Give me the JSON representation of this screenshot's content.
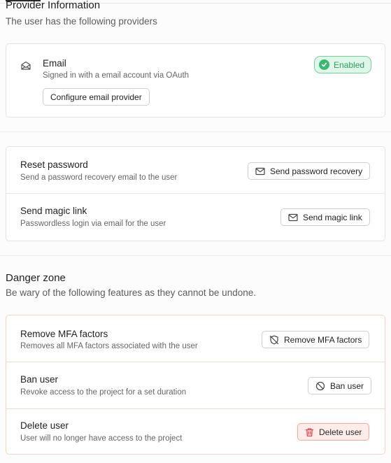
{
  "provider_section": {
    "title": "Provider Information",
    "subtitle": "The user has the following providers",
    "provider": {
      "icon": "mail-open-icon",
      "name": "Email",
      "description": "Signed in with a email account via OAuth",
      "configure_label": "Configure email provider",
      "status_label": "Enabled",
      "status_icon": "check-circle-icon",
      "status_color": "#3bb873"
    }
  },
  "actions_section": {
    "items": [
      {
        "title": "Reset password",
        "description": "Send a password recovery email to the user",
        "button_label": "Send password recovery",
        "button_icon": "mail-icon"
      },
      {
        "title": "Send magic link",
        "description": "Passwordless login via email for the user",
        "button_label": "Send magic link",
        "button_icon": "mail-icon"
      }
    ]
  },
  "danger_section": {
    "title": "Danger zone",
    "subtitle": "Be wary of the following features as they cannot be undone.",
    "accent_color": "#e5484d",
    "items": [
      {
        "title": "Remove MFA factors",
        "description": "Removes all MFA factors associated with the user",
        "button_label": "Remove MFA factors",
        "button_icon": "shield-off-icon"
      },
      {
        "title": "Ban user",
        "description": "Revoke access to the project for a set duration",
        "button_label": "Ban user",
        "button_icon": "ban-icon"
      },
      {
        "title": "Delete user",
        "description": "User will no longer have access to the project",
        "button_label": "Delete user",
        "button_icon": "trash-icon"
      }
    ]
  }
}
